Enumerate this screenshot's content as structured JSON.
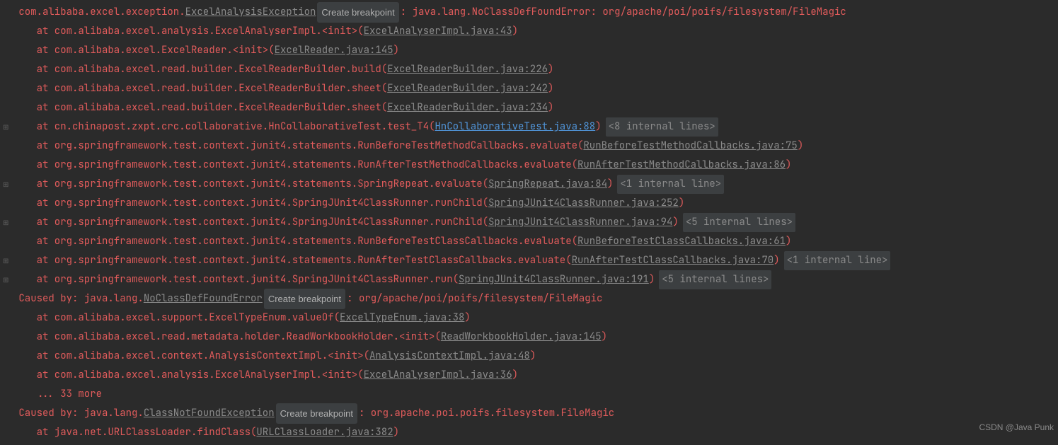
{
  "exception": {
    "class_prefix": "com.alibaba.excel.exception.",
    "class_name": "ExcelAnalysisException",
    "create_bp": "Create breakpoint",
    "message": ": java.lang.NoClassDefFoundError: org/apache/poi/poifs/filesystem/FileMagic"
  },
  "stack": [
    {
      "expand": "",
      "at": "    at com.alibaba.excel.analysis.ExcelAnalyserImpl.<init>(",
      "link": "ExcelAnalyserImpl.java:43",
      "suffix": ")",
      "hidden": ""
    },
    {
      "expand": "",
      "at": "    at com.alibaba.excel.ExcelReader.<init>(",
      "link": "ExcelReader.java:145",
      "suffix": ")",
      "hidden": ""
    },
    {
      "expand": "",
      "at": "    at com.alibaba.excel.read.builder.ExcelReaderBuilder.build(",
      "link": "ExcelReaderBuilder.java:226",
      "suffix": ")",
      "hidden": ""
    },
    {
      "expand": "",
      "at": "    at com.alibaba.excel.read.builder.ExcelReaderBuilder.sheet(",
      "link": "ExcelReaderBuilder.java:242",
      "suffix": ")",
      "hidden": ""
    },
    {
      "expand": "",
      "at": "    at com.alibaba.excel.read.builder.ExcelReaderBuilder.sheet(",
      "link": "ExcelReaderBuilder.java:234",
      "suffix": ")",
      "hidden": ""
    },
    {
      "expand": "⊞",
      "at": "    at cn.chinapost.zxpt.crc.collaborative.HnCollaborativeTest.test_T4(",
      "link": "HnCollaborativeTest.java:88",
      "linkBlue": true,
      "suffix": ")",
      "hidden": "<8 internal lines>"
    },
    {
      "expand": "",
      "at": "    at org.springframework.test.context.junit4.statements.RunBeforeTestMethodCallbacks.evaluate(",
      "link": "RunBeforeTestMethodCallbacks.java:75",
      "suffix": ")",
      "hidden": ""
    },
    {
      "expand": "",
      "at": "    at org.springframework.test.context.junit4.statements.RunAfterTestMethodCallbacks.evaluate(",
      "link": "RunAfterTestMethodCallbacks.java:86",
      "suffix": ")",
      "hidden": ""
    },
    {
      "expand": "⊞",
      "at": "    at org.springframework.test.context.junit4.statements.SpringRepeat.evaluate(",
      "link": "SpringRepeat.java:84",
      "suffix": ")",
      "hidden": "<1 internal line>"
    },
    {
      "expand": "",
      "at": "    at org.springframework.test.context.junit4.SpringJUnit4ClassRunner.runChild(",
      "link": "SpringJUnit4ClassRunner.java:252",
      "suffix": ")",
      "hidden": ""
    },
    {
      "expand": "⊞",
      "at": "    at org.springframework.test.context.junit4.SpringJUnit4ClassRunner.runChild(",
      "link": "SpringJUnit4ClassRunner.java:94",
      "suffix": ")",
      "hidden": "<5 internal lines>"
    },
    {
      "expand": "",
      "at": "    at org.springframework.test.context.junit4.statements.RunBeforeTestClassCallbacks.evaluate(",
      "link": "RunBeforeTestClassCallbacks.java:61",
      "suffix": ")",
      "hidden": ""
    },
    {
      "expand": "⊞",
      "at": "    at org.springframework.test.context.junit4.statements.RunAfterTestClassCallbacks.evaluate(",
      "link": "RunAfterTestClassCallbacks.java:70",
      "suffix": ")",
      "hidden": "<1 internal line>"
    },
    {
      "expand": "⊞",
      "at": "    at org.springframework.test.context.junit4.SpringJUnit4ClassRunner.run(",
      "link": "SpringJUnit4ClassRunner.java:191",
      "suffix": ")",
      "hidden": "<5 internal lines>"
    }
  ],
  "caused1": {
    "prefix": " Caused by: java.lang.",
    "class_name": "NoClassDefFoundError",
    "create_bp": "Create breakpoint",
    "message": ": org/apache/poi/poifs/filesystem/FileMagic"
  },
  "caused1_stack": [
    {
      "at": "    at com.alibaba.excel.support.ExcelTypeEnum.valueOf(",
      "link": "ExcelTypeEnum.java:38",
      "suffix": ")"
    },
    {
      "at": "    at com.alibaba.excel.read.metadata.holder.ReadWorkbookHolder.<init>(",
      "link": "ReadWorkbookHolder.java:145",
      "suffix": ")"
    },
    {
      "at": "    at com.alibaba.excel.context.AnalysisContextImpl.<init>(",
      "link": "AnalysisContextImpl.java:48",
      "suffix": ")"
    },
    {
      "at": "    at com.alibaba.excel.analysis.ExcelAnalyserImpl.<init>(",
      "link": "ExcelAnalyserImpl.java:36",
      "suffix": ")"
    }
  ],
  "more1": "    ... 33 more",
  "caused2": {
    "prefix": " Caused by: java.lang.",
    "class_name": "ClassNotFoundException",
    "create_bp": "Create breakpoint",
    "message": ": org.apache.poi.poifs.filesystem.FileMagic"
  },
  "caused2_stack": [
    {
      "at": "    at java.net.URLClassLoader.findClass(",
      "link": "URLClassLoader.java:382",
      "suffix": ")"
    }
  ],
  "watermark": "CSDN @Java Punk"
}
